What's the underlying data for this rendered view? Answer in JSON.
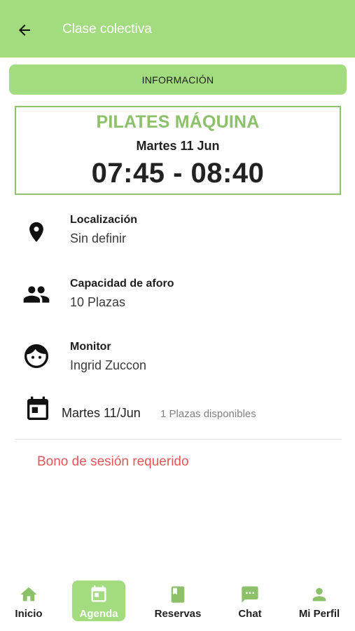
{
  "appbar": {
    "title": "Clase colectiva"
  },
  "tabs": {
    "info_label": "INFORMACIÓN"
  },
  "class_card": {
    "name": "PILATES MÁQUINA",
    "date": "Martes 11 Jun",
    "time": "07:45 - 08:40"
  },
  "details": {
    "location": {
      "label": "Localización",
      "value": "Sin definir"
    },
    "capacity": {
      "label": "Capacidad de aforo",
      "value": "10 Plazas"
    },
    "monitor": {
      "label": "Monitor",
      "value": "Ingrid Zuccon"
    }
  },
  "session": {
    "date": "Martes 11/Jun",
    "availability": "1 Plazas disponibles"
  },
  "notice": "Bono de sesión requerido",
  "bottom_nav": {
    "items": [
      {
        "label": "Inicio",
        "icon": "home-icon"
      },
      {
        "label": "Agenda",
        "icon": "calendar-icon"
      },
      {
        "label": "Reservas",
        "icon": "book-icon"
      },
      {
        "label": "Chat",
        "icon": "chat-icon"
      },
      {
        "label": "Mi Perfil",
        "icon": "person-icon"
      }
    ],
    "active_index": 1
  },
  "colors": {
    "accent": "#a3db7f",
    "title_green": "#8cc16a",
    "warning_red": "#e05757"
  }
}
